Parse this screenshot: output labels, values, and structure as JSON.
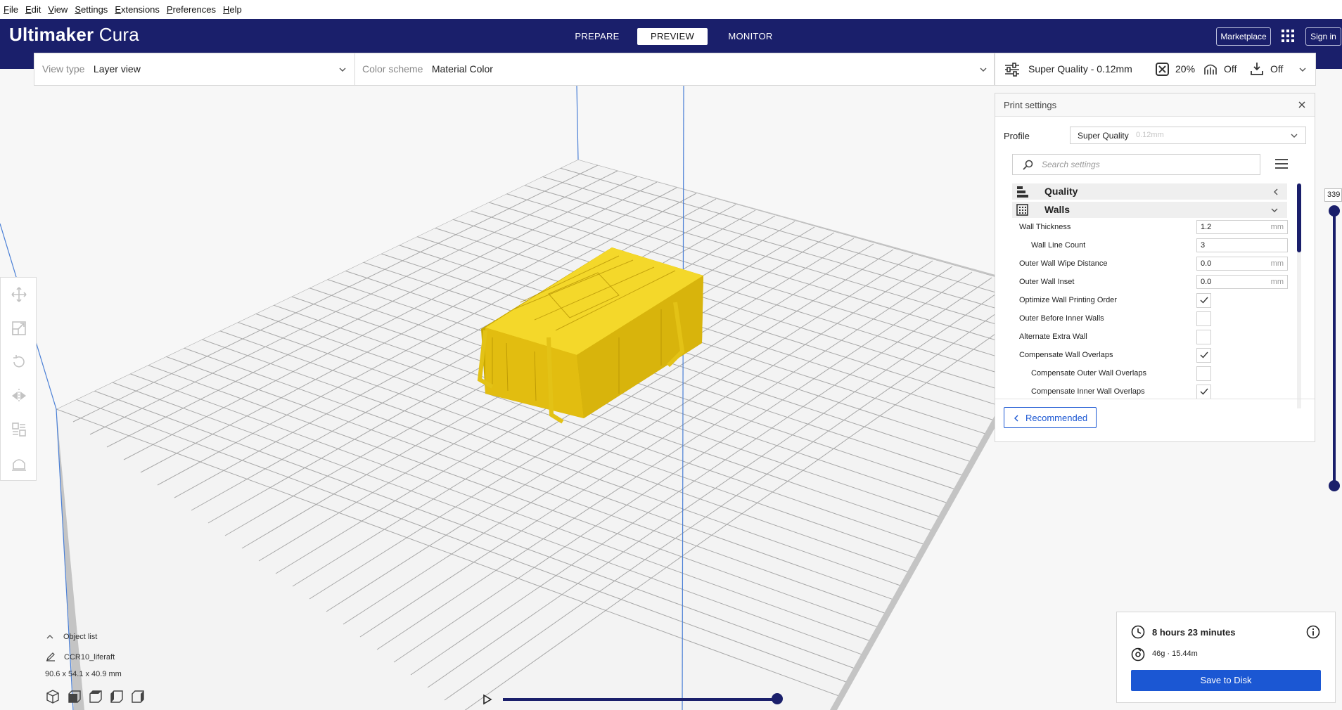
{
  "menubar": {
    "items": [
      "File",
      "Edit",
      "View",
      "Settings",
      "Extensions",
      "Preferences",
      "Help"
    ]
  },
  "header": {
    "app_title_bold": "Ultimaker",
    "app_title_light": "Cura",
    "stages": {
      "prepare": "PREPARE",
      "preview": "PREVIEW",
      "monitor": "MONITOR"
    },
    "marketplace": "Marketplace",
    "sign_in": "Sign in"
  },
  "view_toolbar": {
    "view_type_label": "View type",
    "view_type_value": "Layer view",
    "color_scheme_label": "Color scheme",
    "color_scheme_value": "Material Color"
  },
  "print_summary": {
    "profile": "Super Quality - 0.12mm",
    "infill": "20%",
    "support": "Off",
    "adhesion": "Off"
  },
  "print_settings": {
    "title": "Print settings",
    "profile_label": "Profile",
    "profile_name": "Super Quality",
    "profile_hint": "0.12mm",
    "search_placeholder": "Search settings",
    "categories": {
      "quality": "Quality",
      "walls": "Walls"
    },
    "rows": [
      {
        "label": "Wall Thickness",
        "value": "1.2",
        "unit": "mm"
      },
      {
        "label": "Wall Line Count",
        "value": "3",
        "unit": ""
      },
      {
        "label": "Outer Wall Wipe Distance",
        "value": "0.0",
        "unit": "mm"
      },
      {
        "label": "Outer Wall Inset",
        "value": "0.0",
        "unit": "mm"
      },
      {
        "label": "Optimize Wall Printing Order",
        "checked": true
      },
      {
        "label": "Outer Before Inner Walls",
        "checked": false
      },
      {
        "label": "Alternate Extra Wall",
        "checked": false
      },
      {
        "label": "Compensate Wall Overlaps",
        "checked": true
      },
      {
        "label": "Compensate Outer Wall Overlaps",
        "checked": false
      },
      {
        "label": "Compensate Inner Wall Overlaps",
        "checked": true
      }
    ],
    "recommended_button": "Recommended"
  },
  "layer_slider": {
    "current_layer": "339"
  },
  "object_list": {
    "toggle_label": "Object list",
    "object_name": "CCR10_liferaft",
    "dimensions": "90.6 x 54.1 x 40.9 mm"
  },
  "job": {
    "time": "8 hours 23 minutes",
    "material": "46g · 15.44m",
    "save_button": "Save to Disk"
  },
  "colors": {
    "header_bg": "#1a1f6b",
    "accent_blue": "#1b57d3",
    "model_yellow": "#f2d21a"
  }
}
